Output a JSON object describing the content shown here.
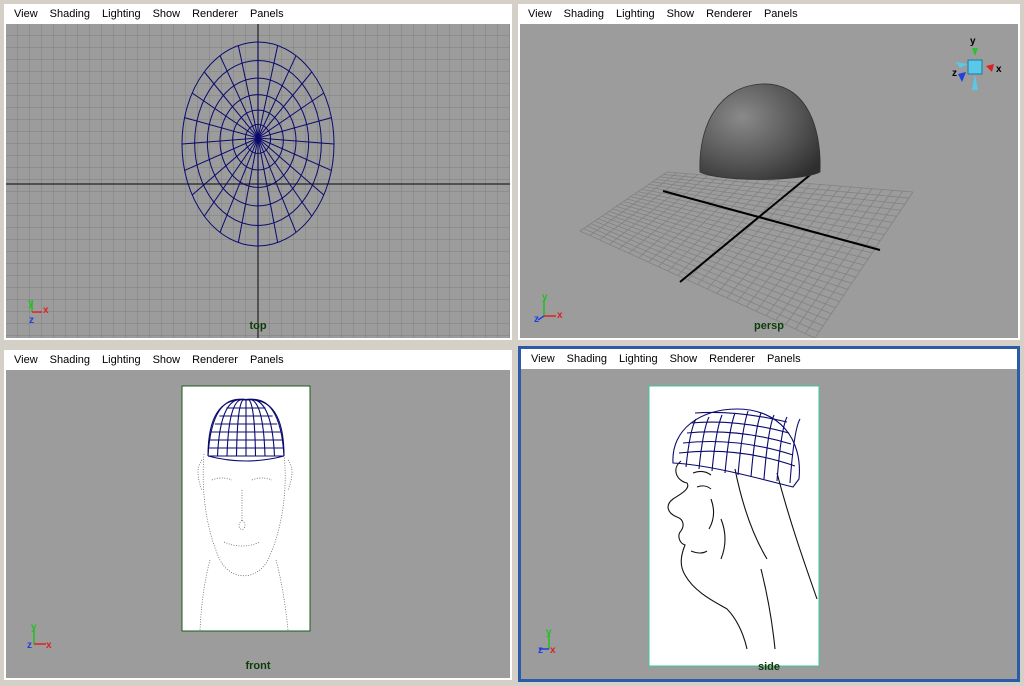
{
  "menu": [
    "View",
    "Shading",
    "Lighting",
    "Show",
    "Renderer",
    "Panels"
  ],
  "viewports": {
    "top": {
      "camera": "top"
    },
    "persp": {
      "camera": "persp"
    },
    "front": {
      "camera": "front"
    },
    "side": {
      "camera": "side"
    }
  },
  "axes": {
    "x": "x",
    "y": "y",
    "z": "z"
  },
  "colors": {
    "viewport_bg": "#9c9c9c",
    "grid": "#7f7f7f",
    "wireframe": "#0a0a6e",
    "camera_label": "#0b3d0b",
    "axis_x": "#e02020",
    "axis_y": "#20c020",
    "axis_z": "#2040e0",
    "active_border": "#2b5aa8"
  }
}
